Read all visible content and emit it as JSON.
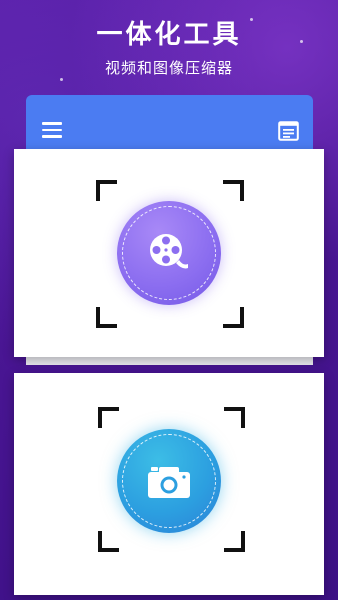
{
  "header": {
    "title": "一体化工具",
    "subtitle": "视频和图像压缩器"
  },
  "toolbar": {
    "menu_icon": "menu-icon",
    "doc_icon": "document-icon"
  },
  "cards": [
    {
      "name": "video-compressor",
      "icon": "film-reel-icon",
      "color": "#8c6ef0"
    },
    {
      "name": "image-compressor",
      "icon": "camera-icon",
      "color": "#2c9fe0"
    }
  ],
  "colors": {
    "background": "#4a1694",
    "topbar": "#4b7cf2",
    "accent_video": "#8c6ef0",
    "accent_photo": "#2c9fe0"
  }
}
